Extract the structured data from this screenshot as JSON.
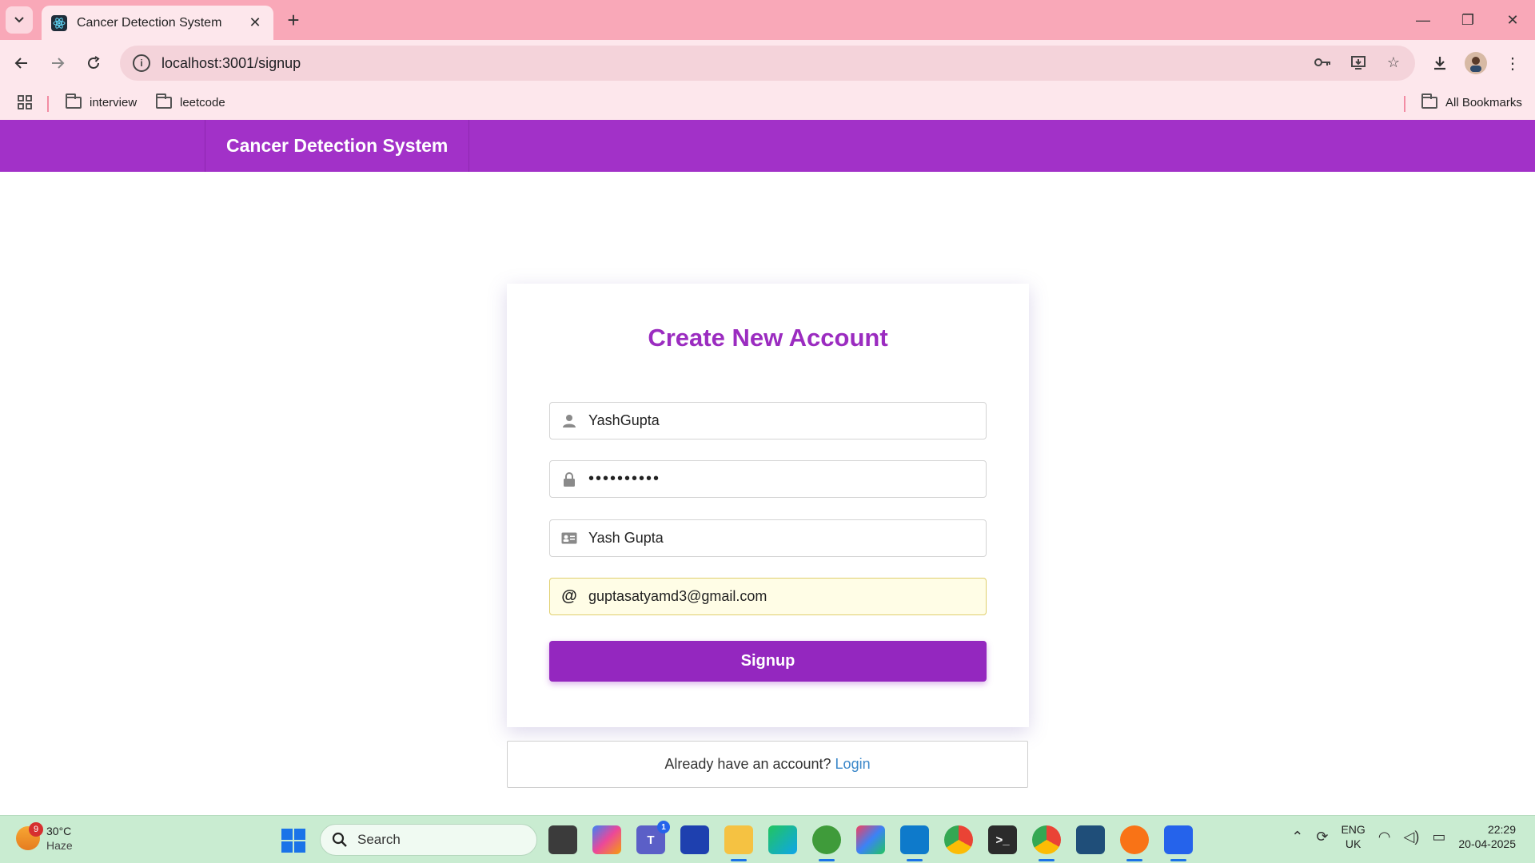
{
  "browser": {
    "tab_title": "Cancer Detection System",
    "url": "localhost:3001/signup",
    "bookmarks": [
      {
        "label": "interview"
      },
      {
        "label": "leetcode"
      }
    ],
    "all_bookmarks_label": "All Bookmarks"
  },
  "app": {
    "brand": "Cancer Detection System",
    "accent_color": "#a231c8"
  },
  "signup_form": {
    "title": "Create New Account",
    "username_value": "YashGupta",
    "password_value": "••••••••••",
    "fullname_value": "Yash Gupta",
    "email_value": "guptasatyamd3@gmail.com",
    "submit_label": "Signup"
  },
  "login_prompt": {
    "text": "Already have an account?",
    "link_label": "Login"
  },
  "taskbar": {
    "weather_badge": "9",
    "temperature": "30°C",
    "condition": "Haze",
    "search_label": "Search",
    "lang_top": "ENG",
    "lang_bottom": "UK",
    "time": "22:29",
    "date": "20-04-2025",
    "teams_badge": "1"
  }
}
